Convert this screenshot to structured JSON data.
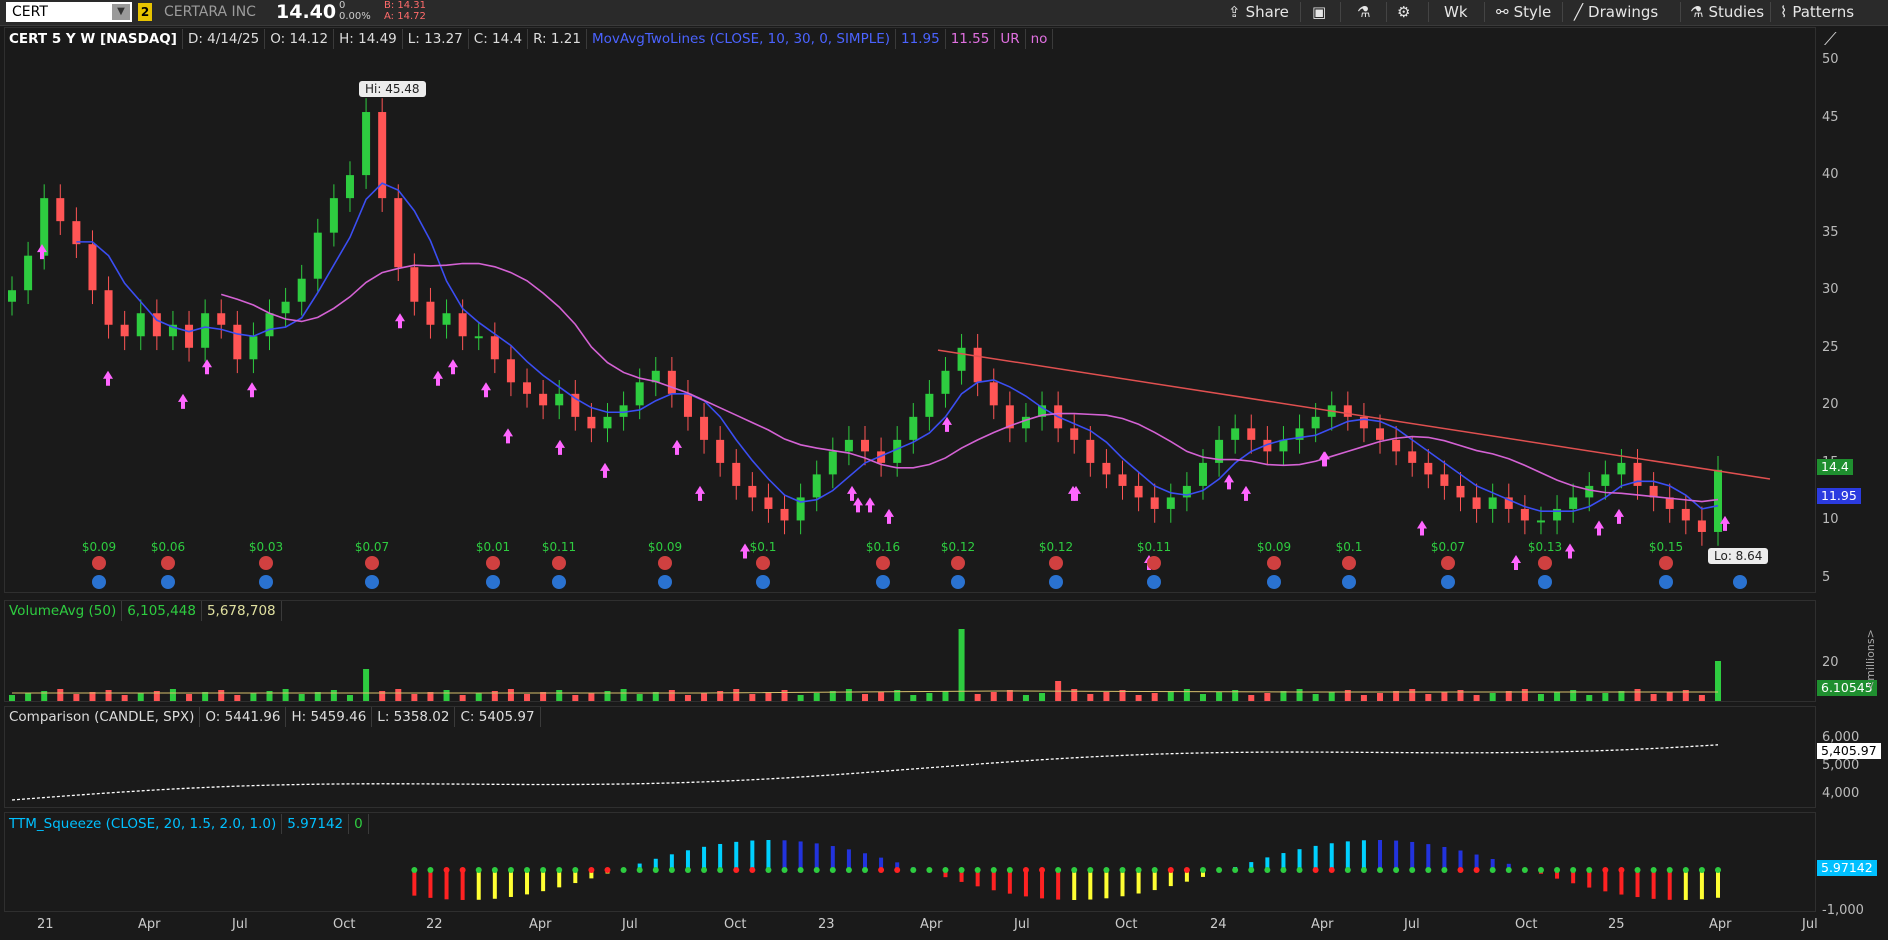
{
  "toolbar": {
    "symbol": "CERT",
    "link_group": "2",
    "company": "CERTARA INC",
    "last_price": "14.40",
    "net_change": "0",
    "pct_change": "0.00%",
    "bid": "B: 14.31",
    "ask": "A: 14.72",
    "share_label": "Share",
    "timeframe_label": "Wk",
    "style_label": "Style",
    "drawings_label": "Drawings",
    "studies_label": "Studies",
    "patterns_label": "Patterns"
  },
  "price_pane": {
    "header": {
      "symbol_desc": "CERT 5 Y W [NASDAQ]",
      "date": "D: 4/14/25",
      "open": "O: 14.12",
      "high": "H: 14.49",
      "low": "L: 13.27",
      "close": "C: 14.4",
      "range": "R: 1.21",
      "study": "MovAvgTwoLines (CLOSE, 10, 30, 0, SIMPLE)",
      "ma_fast": "11.95",
      "ma_slow": "11.55",
      "ur": "UR",
      "no": "no"
    },
    "hi_label": "Hi: 45.48",
    "lo_label": "Lo: 8.64",
    "price_tag": "14.4",
    "ma_tag": "11.95",
    "y_ticks": [
      "50",
      "45",
      "40",
      "35",
      "30",
      "25",
      "20",
      "15",
      "10",
      "5"
    ],
    "earnings": [
      "$0.09",
      "$0.06",
      "$0.03",
      "$0.07",
      "$0.01",
      "$0.11",
      "$0.09",
      "$0.1",
      "$0.16",
      "$0.12",
      "$0.12",
      "$0.11",
      "$0.09",
      "$0.1",
      "$0.07",
      "$0.13",
      "$0.15"
    ]
  },
  "volume_pane": {
    "study": "VolumeAvg (50)",
    "v1": "6,105,448",
    "v2": "5,678,708",
    "y_tick": "20",
    "tag": "6.10545",
    "units": "<millions>"
  },
  "comparison_pane": {
    "study": "Comparison (CANDLE, SPX)",
    "open": "O: 5441.96",
    "high": "H: 5459.46",
    "low": "L: 5358.02",
    "close": "C: 5405.97",
    "y_ticks": [
      "6,000",
      "5,000",
      "4,000"
    ],
    "tag": "5,405.97"
  },
  "squeeze_pane": {
    "study": "TTM_Squeeze (CLOSE, 20, 1.5, 2.0, 1.0)",
    "value": "5.97142",
    "zero": "0",
    "tag": "5.97142",
    "y_tick": "-1,000"
  },
  "x_axis": [
    "21",
    "Apr",
    "Jul",
    "Oct",
    "22",
    "Apr",
    "Jul",
    "Oct",
    "23",
    "Apr",
    "Jul",
    "Oct",
    "24",
    "Apr",
    "Jul",
    "Oct",
    "25",
    "Apr",
    "Jul"
  ],
  "colors": {
    "up": "#2ecc40",
    "down": "#ff5555",
    "ma_fast": "#3b4ef2",
    "ma_slow": "#d462d4",
    "trend": "#e05050",
    "accent": "#00c0ff"
  },
  "chart_data": {
    "type": "candlestick",
    "title": "CERT 5 Y W [NASDAQ]",
    "ylim": [
      5,
      50
    ],
    "close_approx": [
      30,
      33,
      38,
      36,
      34,
      30,
      27,
      26,
      28,
      26,
      27,
      25,
      28,
      27,
      24,
      26,
      28,
      29,
      31,
      35,
      38,
      40,
      45.48,
      38,
      32,
      29,
      27,
      28,
      26,
      26,
      24,
      22,
      21,
      20,
      21,
      19,
      18,
      19,
      20,
      22,
      23,
      21,
      19,
      17,
      15,
      13,
      12,
      11,
      10,
      12,
      14,
      16,
      17,
      16,
      15,
      17,
      19,
      21,
      23,
      25,
      22,
      20,
      18,
      19,
      20,
      18,
      17,
      15,
      14,
      13,
      12,
      11,
      12,
      13,
      15,
      17,
      18,
      17,
      16,
      17,
      18,
      19,
      20,
      19,
      18,
      17,
      16,
      15,
      14,
      13,
      12,
      11,
      12,
      11,
      10,
      10,
      11,
      12,
      13,
      14,
      15,
      13,
      12,
      11,
      10,
      9,
      14.4
    ]
  }
}
